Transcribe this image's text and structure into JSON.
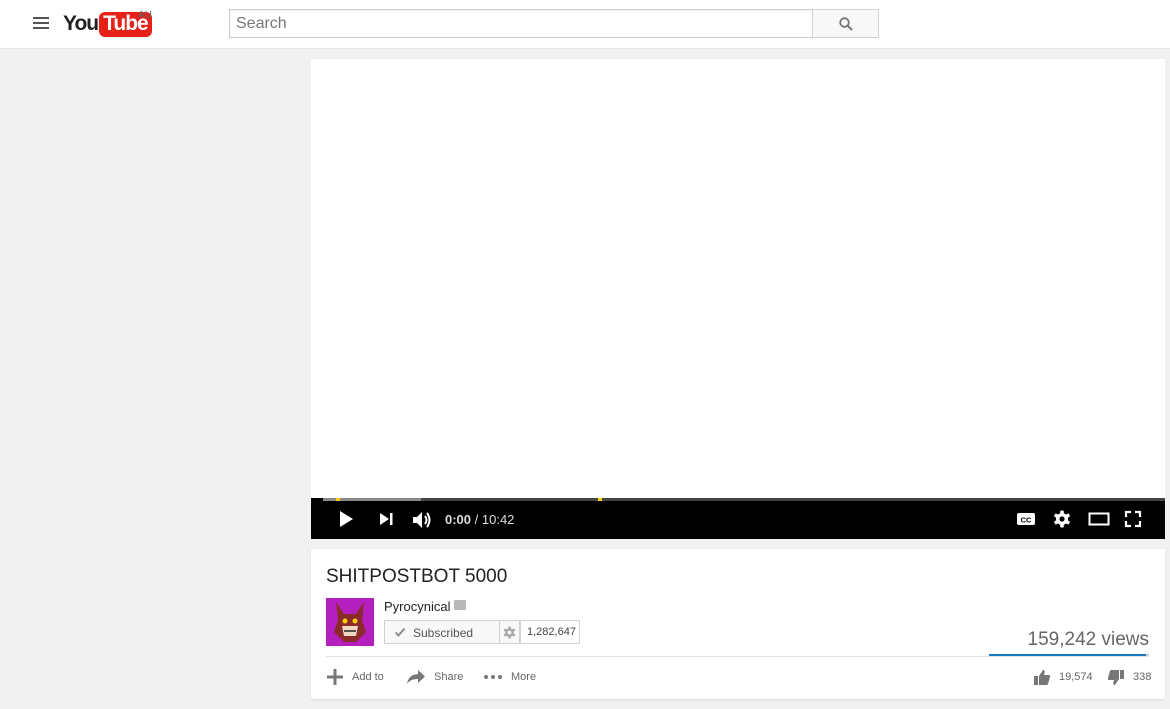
{
  "masthead": {
    "logo_you": "You",
    "logo_tube": "Tube",
    "region": "AU",
    "search_placeholder": "Search"
  },
  "player": {
    "current_time": "0:00",
    "separator": " / ",
    "duration": "10:42",
    "buffered_fraction": 0.116
  },
  "video": {
    "title": "SHITPOSTBOT 5000",
    "channel": "Pyrocynical",
    "subscribe_label": "Subscribed",
    "subscriber_count": "1,282,647",
    "views": "159,242 views",
    "likes": "19,574",
    "dislikes": "338",
    "like_fraction": 0.983
  },
  "actions": {
    "add_to": "Add to",
    "share": "Share",
    "more": "More"
  },
  "colors": {
    "brand_red": "#e62117",
    "like_bar_blue": "#167ac6",
    "ad_marker_yellow": "#ffcc00"
  }
}
